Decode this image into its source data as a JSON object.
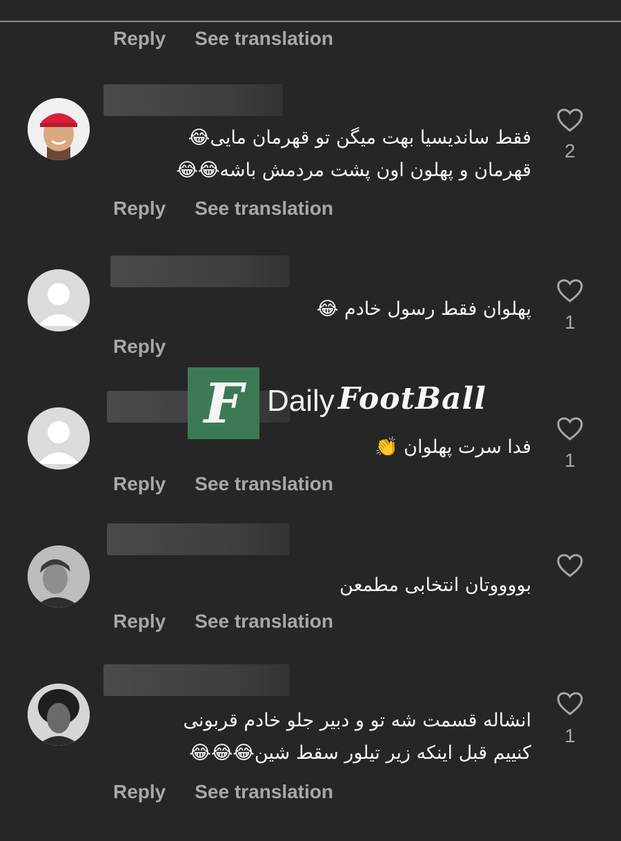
{
  "ui": {
    "reply": "Reply",
    "see_translation": "See translation"
  },
  "watermark": {
    "letter": "F",
    "word1": "Daily",
    "word2": "FootBall"
  },
  "comments": [
    {
      "lines": [
        "فقط ساندیسیا بهت میگن تو قهرمان مایی😂",
        "قهرمان و پهلون اون پشت مردمش باشه😂😂"
      ],
      "likes": "2",
      "avatar": "profile-photo"
    },
    {
      "lines": [
        "پهلوان فقط رسول خادم 😂"
      ],
      "likes": "1",
      "avatar": "default-avatar"
    },
    {
      "lines": [
        "فدا سرت پهلوان 👏"
      ],
      "likes": "1",
      "avatar": "default-avatar"
    },
    {
      "lines": [
        "بووووتان انتخابی مطمعن"
      ],
      "likes": "",
      "avatar": "profile-photo"
    },
    {
      "lines": [
        "انشاله قسمت شه تو و دبیر جلو خادم قربونی",
        "کنییم قبل اینکه زیر تیلور سقط شین😂😂😂"
      ],
      "likes": "1",
      "avatar": "profile-photo"
    }
  ]
}
